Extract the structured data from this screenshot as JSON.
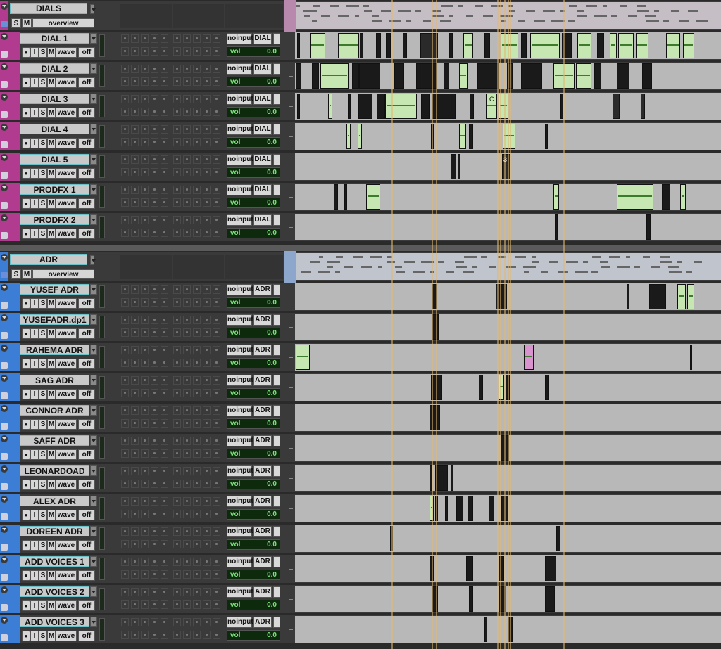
{
  "colors": {
    "dials_track": "#b13c8f",
    "adr_track": "#3c7ed6",
    "clip_green": "#c6e7b1",
    "clip_pink": "#d994cf",
    "clip_black": "#111111",
    "timeline_line": "#e3b870"
  },
  "groups": [
    {
      "name": "DIALS",
      "solo": "S",
      "mute": "M",
      "view": "overview",
      "color": "#b13c8f",
      "tracks": [
        {
          "name": "DIAL 1",
          "input": "noinput",
          "output": "DIAL",
          "vol_label": "vol",
          "vol": "0.0"
        },
        {
          "name": "DIAL 2",
          "input": "noinput",
          "output": "DIAL",
          "vol_label": "vol",
          "vol": "0.0"
        },
        {
          "name": "DIAL 3",
          "input": "noinput",
          "output": "DIAL",
          "vol_label": "vol",
          "vol": "0.0"
        },
        {
          "name": "DIAL 4",
          "input": "noinput",
          "output": "DIAL",
          "vol_label": "vol",
          "vol": "0.0"
        },
        {
          "name": "DIAL 5",
          "input": "noinput",
          "output": "DIAL",
          "vol_label": "vol",
          "vol": "0.0"
        },
        {
          "name": "PRODFX 1",
          "input": "noinput",
          "output": "DIAL",
          "vol_label": "vol",
          "vol": "0.0"
        },
        {
          "name": "PRODFX 2",
          "input": "noinput",
          "output": "DIAL",
          "vol_label": "vol",
          "vol": "0.0"
        }
      ]
    },
    {
      "name": "ADR",
      "solo": "S",
      "mute": "M",
      "view": "overview",
      "color": "#3c7ed6",
      "tracks": [
        {
          "name": "YUSEF ADR",
          "input": "noinput",
          "output": "ADR",
          "vol_label": "vol",
          "vol": "0.0"
        },
        {
          "name": "YUSEFADR.dp1",
          "input": "noinput",
          "output": "ADR",
          "vol_label": "vol",
          "vol": "0.0"
        },
        {
          "name": "RAHEMA ADR",
          "input": "noinput",
          "output": "ADR",
          "vol_label": "vol",
          "vol": "0.0"
        },
        {
          "name": "SAG ADR",
          "input": "noinput",
          "output": "ADR",
          "vol_label": "vol",
          "vol": "0.0"
        },
        {
          "name": "CONNOR ADR",
          "input": "noinput",
          "output": "ADR",
          "vol_label": "vol",
          "vol": "0.0"
        },
        {
          "name": "SAFF ADR",
          "input": "noinput",
          "output": "ADR",
          "vol_label": "vol",
          "vol": "0.0"
        },
        {
          "name": "LEONARDOAD",
          "input": "noinput",
          "output": "ADR",
          "vol_label": "vol",
          "vol": "0.0"
        },
        {
          "name": "ALEX ADR",
          "input": "noinput",
          "output": "ADR",
          "vol_label": "vol",
          "vol": "0.0"
        },
        {
          "name": "DOREEN ADR",
          "input": "noinput",
          "output": "ADR",
          "vol_label": "vol",
          "vol": "0.0"
        },
        {
          "name": "ADD VOICES 1",
          "input": "noinput",
          "output": "ADR",
          "vol_label": "vol",
          "vol": "0.0"
        },
        {
          "name": "ADD VOICES 2",
          "input": "noinput",
          "output": "ADR",
          "vol_label": "vol",
          "vol": "0.0"
        },
        {
          "name": "ADD VOICES 3",
          "input": "noinput",
          "output": "ADR",
          "vol_label": "vol",
          "vol": "0.0"
        }
      ]
    }
  ],
  "track_buttons": {
    "rec": "●",
    "input": "I",
    "solo": "S",
    "mute": "M",
    "view": "wave",
    "auto": "off"
  },
  "clip_labels": {
    "dial3": "C",
    "dial5": "3"
  }
}
